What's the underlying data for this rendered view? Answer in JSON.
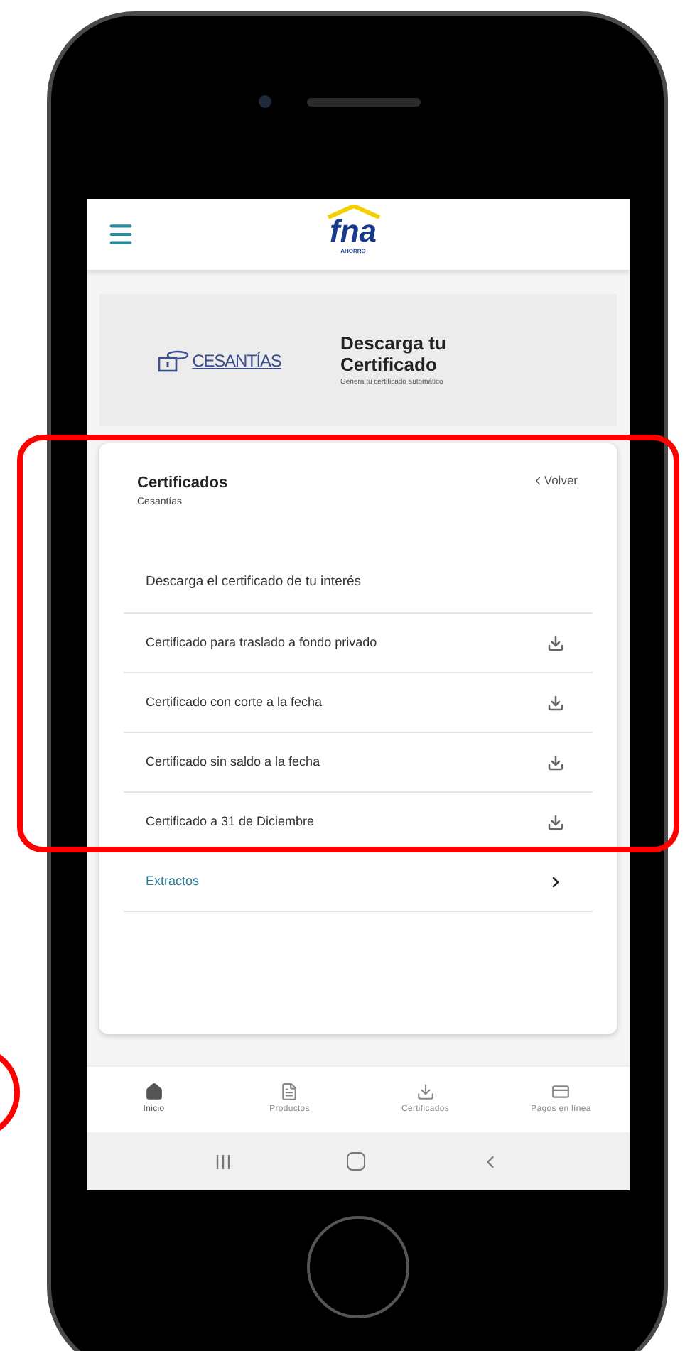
{
  "header": {
    "logo": "fna",
    "logo_subtext": "AHORRO"
  },
  "banner": {
    "brand": "CESANTÍAS",
    "title": "Descarga tu Certificado",
    "subtitle": "Genera tu certificado automático"
  },
  "card": {
    "title": "Certificados",
    "subtitle": "Cesantías",
    "back": "Volver",
    "intro": "Descarga el certificado de tu interés",
    "items": [
      {
        "label": "Certificado para traslado a fondo privado",
        "kind": "download"
      },
      {
        "label": "Certificado con corte a la fecha",
        "kind": "download"
      },
      {
        "label": "Certificado sin saldo a la fecha",
        "kind": "download"
      },
      {
        "label": "Certificado a 31 de Diciembre",
        "kind": "download"
      },
      {
        "label": "Extractos",
        "kind": "link"
      }
    ]
  },
  "bottom_nav": [
    {
      "label": "Inicio",
      "kind": "home",
      "selected": true
    },
    {
      "label": "Productos",
      "kind": "products",
      "selected": false
    },
    {
      "label": "Certificados",
      "kind": "download",
      "selected": false
    },
    {
      "label": "Pagos en línea",
      "kind": "card",
      "selected": false
    }
  ]
}
